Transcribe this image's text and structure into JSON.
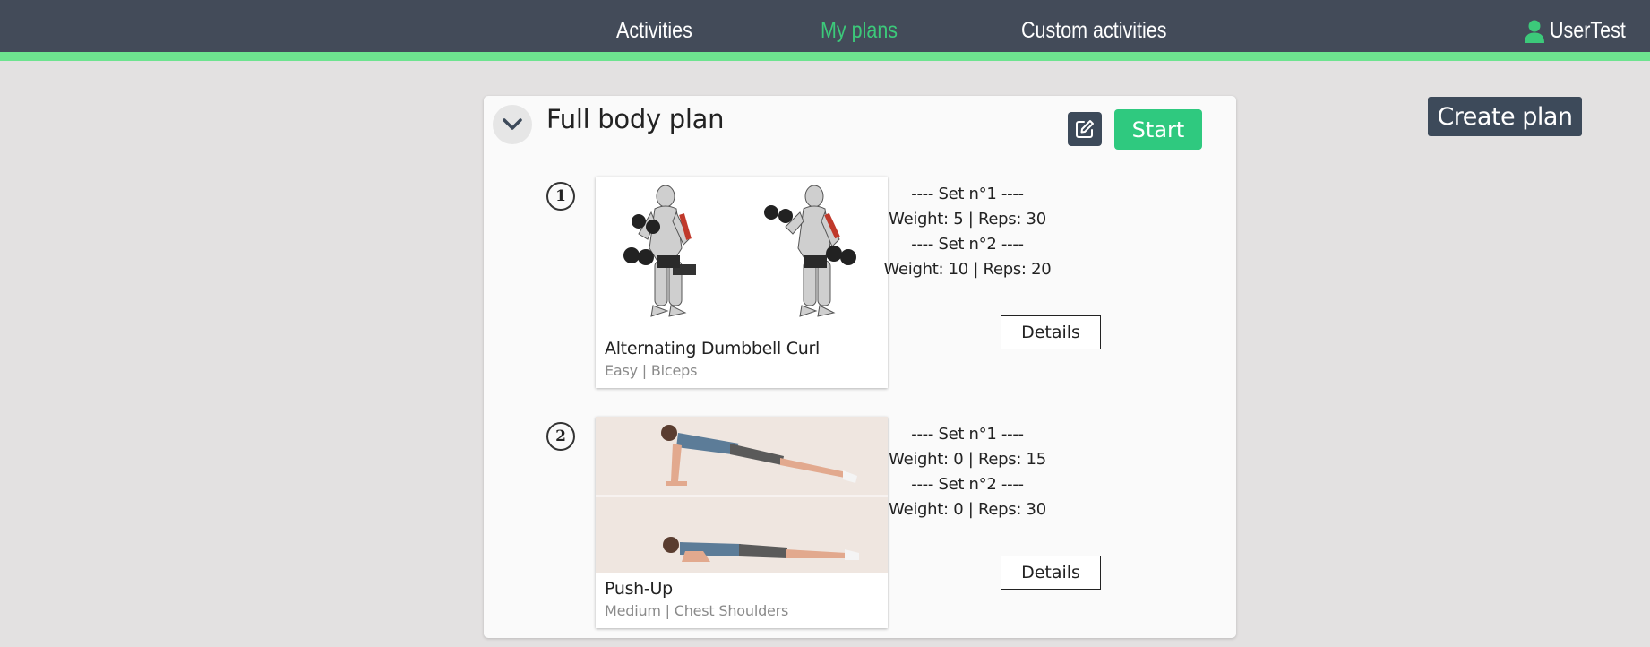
{
  "nav": {
    "links": [
      "Activities",
      "My plans",
      "Custom activities"
    ],
    "active_index": 1,
    "user_name": "UserTest",
    "user_icon": "user-icon"
  },
  "colors": {
    "navbar_bg": "#434b59",
    "accent_green": "#6ee38f",
    "active_link": "#3cc97a",
    "start_button": "#2fc97f",
    "dark_button": "#3d4a5a",
    "page_bg": "#e3e1e1"
  },
  "create_plan_label": "Create plan",
  "plan": {
    "title": "Full body plan",
    "collapse_icon": "chevron-down-icon",
    "edit_icon": "edit-icon",
    "start_label": "Start",
    "exercises": [
      {
        "number": "1",
        "name": "Alternating Dumbbell Curl",
        "meta": "Easy | Biceps",
        "image": "dumbbell-curl-illustration",
        "sets": [
          "---- Set n°1 ----",
          "Weight: 5 | Reps: 30",
          "---- Set n°2 ----",
          "Weight: 10 | Reps: 20"
        ],
        "details_label": "Details"
      },
      {
        "number": "2",
        "name": "Push-Up",
        "meta": "Medium | Chest Shoulders",
        "image": "push-up-photo",
        "sets": [
          "---- Set n°1 ----",
          "Weight: 0 | Reps: 15",
          "---- Set n°2 ----",
          "Weight: 0 | Reps: 30"
        ],
        "details_label": "Details"
      }
    ]
  }
}
